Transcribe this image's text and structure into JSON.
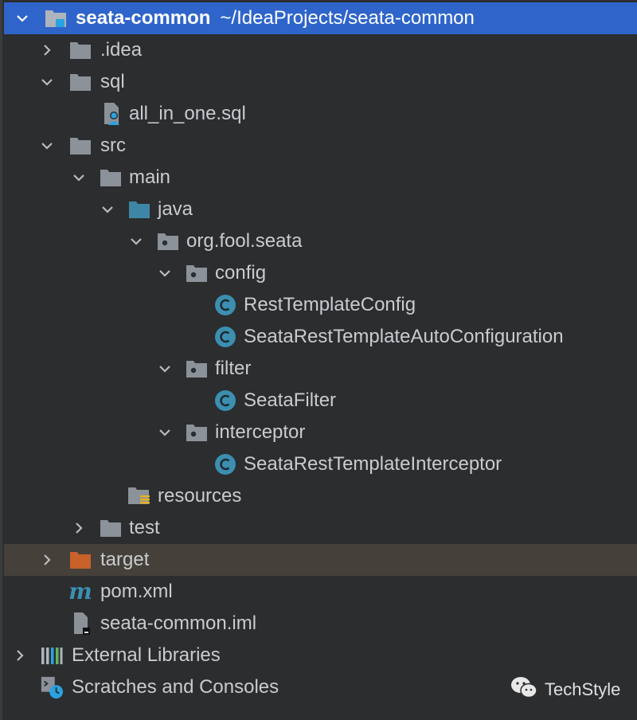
{
  "colors": {
    "background": "#2b2d2f",
    "selection": "#2f65ca",
    "excluded_row": "#45403a",
    "folder": "#8c9299",
    "source_folder": "#3f86a6",
    "class_icon": "#3c8fb0",
    "excluded_folder": "#c8612a"
  },
  "tree": {
    "root": {
      "name": "seata-common",
      "path": "~/IdeaProjects/seata-common"
    },
    "idea": ".idea",
    "sql": "sql",
    "sql_file": "all_in_one.sql",
    "src": "src",
    "main": "main",
    "java": "java",
    "package": "org.fool.seata",
    "config": "config",
    "config_class_1": "RestTemplateConfig",
    "config_class_2": "SeataRestTemplateAutoConfiguration",
    "filter": "filter",
    "filter_class": "SeataFilter",
    "interceptor": "interceptor",
    "interceptor_class": "SeataRestTemplateInterceptor",
    "resources": "resources",
    "test": "test",
    "target": "target",
    "pom": "pom.xml",
    "iml": "seata-common.iml",
    "external_libraries": "External Libraries",
    "scratches": "Scratches and Consoles"
  },
  "watermark": {
    "text": "TechStyle"
  }
}
